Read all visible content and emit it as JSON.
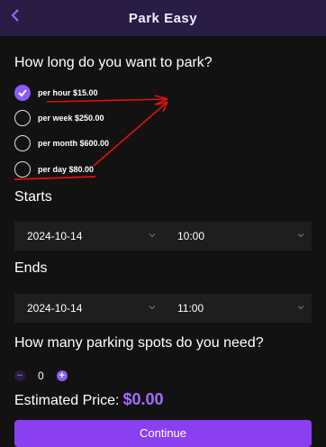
{
  "header": {
    "title": "Park Easy",
    "back_icon": "chevron-left-icon"
  },
  "duration": {
    "question": "How long do you want to park?",
    "options": [
      {
        "label": "per hour $15.00",
        "selected": true
      },
      {
        "label": "per week $250.00",
        "selected": false
      },
      {
        "label": "per month $600.00",
        "selected": false
      },
      {
        "label": "per day $80.00",
        "selected": false
      }
    ]
  },
  "starts": {
    "label": "Starts",
    "date": "2024-10-14",
    "time": "10:00"
  },
  "ends": {
    "label": "Ends",
    "date": "2024-10-14",
    "time": "11:00"
  },
  "spots": {
    "question": "How many parking spots do you need?",
    "minus": "−",
    "quantity": "0",
    "plus": "+"
  },
  "estimate": {
    "label": "Estimated Price:",
    "value": "$0.00"
  },
  "cta": {
    "label": "Continue"
  },
  "colors": {
    "accent": "#8a5cf6",
    "annotation": "#e01010",
    "background": "#121212"
  }
}
